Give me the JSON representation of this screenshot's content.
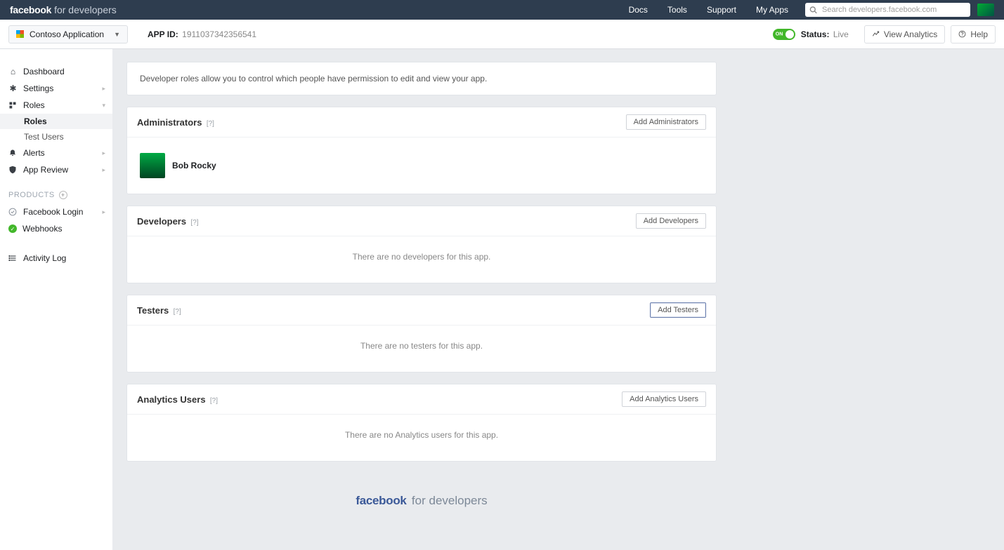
{
  "topnav": {
    "brand_fb": "facebook",
    "brand_fd": "for developers",
    "links": {
      "docs": "Docs",
      "tools": "Tools",
      "support": "Support",
      "myapps": "My Apps"
    },
    "search_placeholder": "Search developers.facebook.com"
  },
  "subheader": {
    "app_name": "Contoso Application",
    "appid_label": "APP ID:",
    "appid_value": "1911037342356541",
    "toggle_label": "ON",
    "status_label": "Status:",
    "status_value": "Live",
    "view_analytics": "View Analytics",
    "help": "Help"
  },
  "sidebar": {
    "items": [
      {
        "label": "Dashboard"
      },
      {
        "label": "Settings"
      },
      {
        "label": "Roles"
      },
      {
        "label": "Alerts"
      },
      {
        "label": "App Review"
      }
    ],
    "roles_sub": {
      "roles": "Roles",
      "test_users": "Test Users"
    },
    "products_label": "PRODUCTS",
    "products": {
      "facebook_login": "Facebook Login",
      "webhooks": "Webhooks"
    },
    "activity_log": "Activity Log"
  },
  "content": {
    "intro": "Developer roles allow you to control which people have permission to edit and view your app.",
    "admins": {
      "title": "Administrators",
      "add_btn": "Add Administrators",
      "users": [
        {
          "name": "Bob Rocky"
        }
      ]
    },
    "devs": {
      "title": "Developers",
      "add_btn": "Add Developers",
      "empty": "There are no developers for this app."
    },
    "testers": {
      "title": "Testers",
      "add_btn": "Add Testers",
      "empty": "There are no testers for this app."
    },
    "analytics": {
      "title": "Analytics Users",
      "add_btn": "Add Analytics Users",
      "empty": "There are no Analytics users for this app."
    }
  },
  "footer": {
    "fb": "facebook",
    "fd": "for developers"
  },
  "help_qmark": "[?]"
}
